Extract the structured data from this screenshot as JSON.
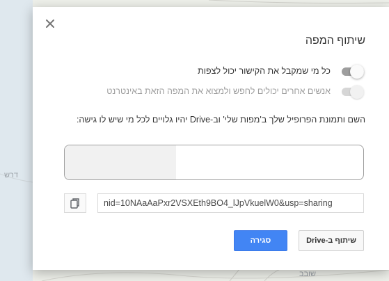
{
  "dialog": {
    "title": "שיתוף המפה",
    "close_icon": "close-icon",
    "toggles": [
      {
        "label": "כל מי שמקבל את הקישור יכול לצפות",
        "enabled": true,
        "disabled": false
      },
      {
        "label": "אנשים אחרים יכולים לחפש ולמצוא את המפה הזאת באינטרנט",
        "enabled": false,
        "disabled": true
      }
    ],
    "profile_notice": "השם ותמונת הפרופיל שלך ב'מפות שלי' וב-Drive יהיו גלויים לכל מי שיש לו גישה:",
    "link_value": "nid=10NAaAaPxr2VSXEth9BO4_lJpVkuelW0&usp=sharing",
    "copy_icon": "copy-icon",
    "buttons": {
      "close_label": "סגירה",
      "drive_label": "שיתוף ב-Drive"
    }
  },
  "map": {
    "labels": [
      "דרש",
      "שובב"
    ]
  },
  "colors": {
    "primary_button": "#4285f4",
    "toggle_track": "#9e9e9e",
    "toggle_track_disabled": "#d6d6d6"
  }
}
